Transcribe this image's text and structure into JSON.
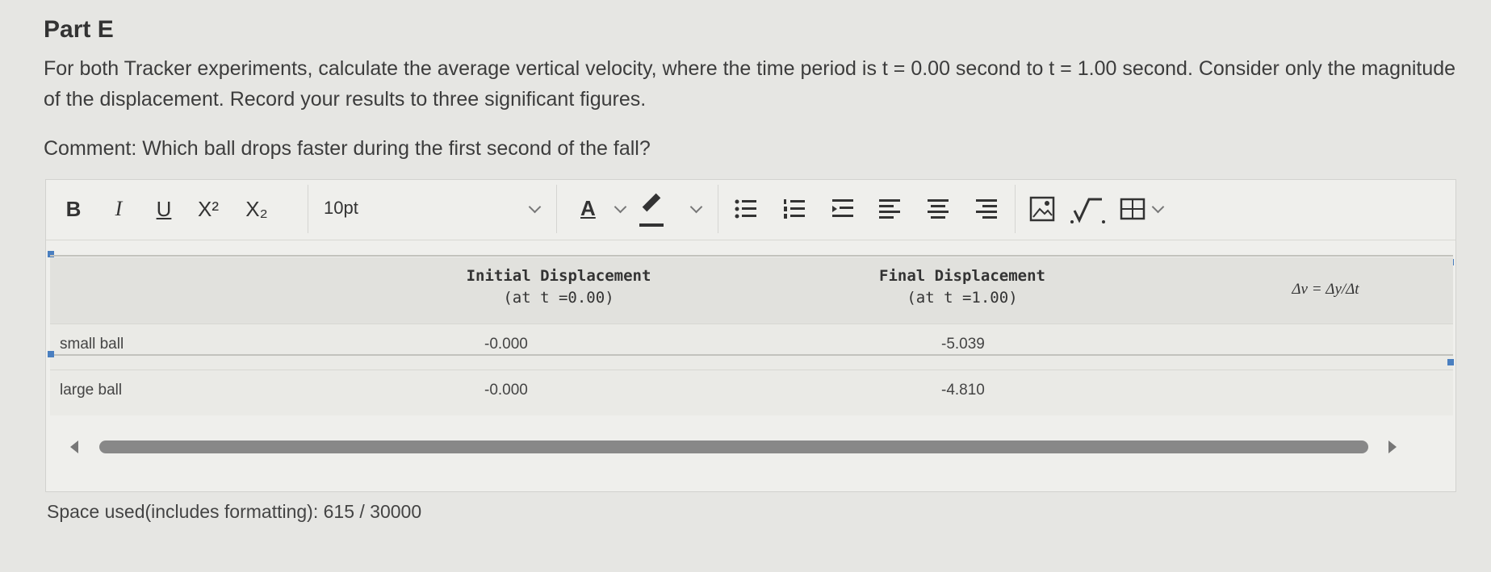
{
  "part": {
    "title": "Part E"
  },
  "question": {
    "text": "For both Tracker experiments, calculate the average vertical velocity, where the time period is t = 0.00 second to t = 1.00 second. Consider only the magnitude of the displacement. Record your results to three significant figures.",
    "comment": "Comment: Which ball drops faster during the first second of the fall?"
  },
  "toolbar": {
    "bold": "B",
    "italic": "I",
    "underline": "U",
    "superscript": "X²",
    "subscript": "X₂",
    "font_size": "10pt",
    "font_color_glyph": "A",
    "icons": [
      "bold-icon",
      "italic-icon",
      "underline-icon",
      "superscript-icon",
      "subscript-icon",
      "chevron-down-icon",
      "text-color-icon",
      "highlight-icon",
      "bullet-list-icon",
      "numbered-list-icon",
      "indent-icon",
      "align-left-icon",
      "align-center-icon",
      "align-right-icon",
      "image-icon",
      "math-icon",
      "table-icon"
    ]
  },
  "table": {
    "headers": [
      {
        "line1": "",
        "line2": ""
      },
      {
        "line1": "Initial Displacement",
        "line2": "(at t =0.00)"
      },
      {
        "line1": "Final Displacement",
        "line2": "(at t =1.00)"
      },
      {
        "line1": "Δv = Δy/Δt",
        "line2": ""
      }
    ],
    "rows": [
      {
        "label": "small ball",
        "initial": "-0.000",
        "final": "-5.039",
        "velocity": ""
      },
      {
        "label": "large ball",
        "initial": "-0.000",
        "final": "-4.810",
        "velocity": ""
      }
    ]
  },
  "status": {
    "space_used": "Space used(includes formatting): 615 / 30000"
  },
  "colors": {
    "background": "#e6e6e3",
    "editor": "#efefec",
    "handle": "#4a7fc0",
    "scrollbar": "#888888"
  }
}
